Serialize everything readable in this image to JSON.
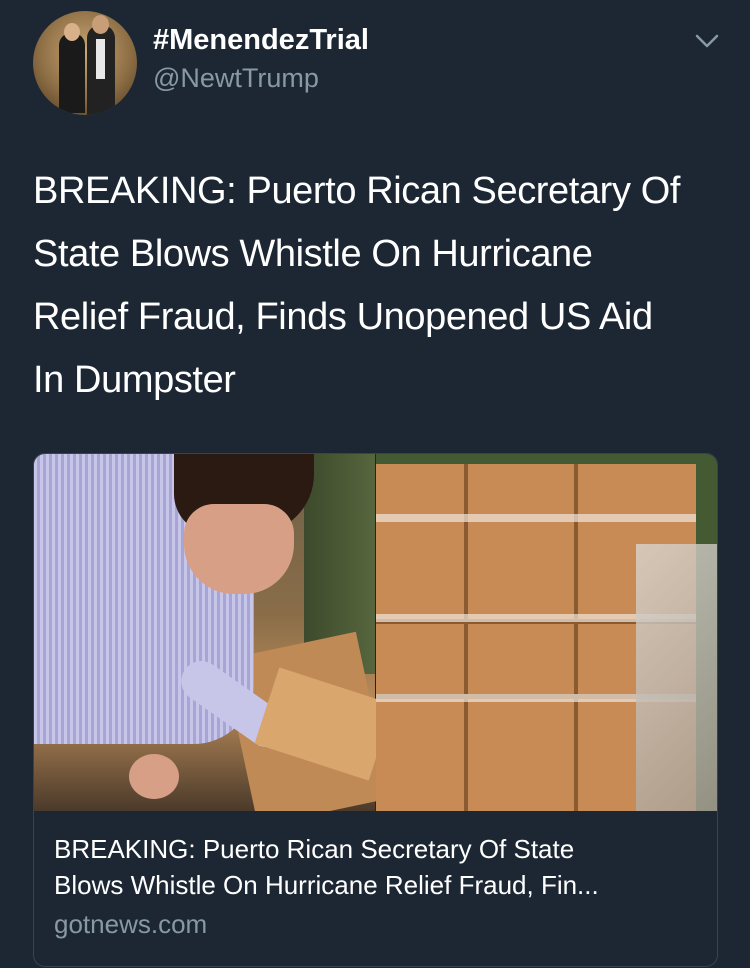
{
  "author": {
    "display_name": "#MenendezTrial",
    "handle": "@NewtTrump"
  },
  "tweet": {
    "text_lines": [
      "BREAKING: Puerto Rican Secretary Of",
      "State Blows Whistle On Hurricane",
      "Relief Fraud, Finds Unopened US Aid",
      "In Dumpster"
    ]
  },
  "card": {
    "title_lines": [
      "BREAKING: Puerto Rican Secretary Of State",
      "Blows Whistle On Hurricane Relief Fraud, Fin..."
    ],
    "domain": "gotnews.com"
  },
  "icons": {
    "menu": "chevron-down-icon"
  },
  "colors": {
    "background": "#1c2733",
    "secondary_text": "#8899a6",
    "card_border": "#38444d"
  }
}
